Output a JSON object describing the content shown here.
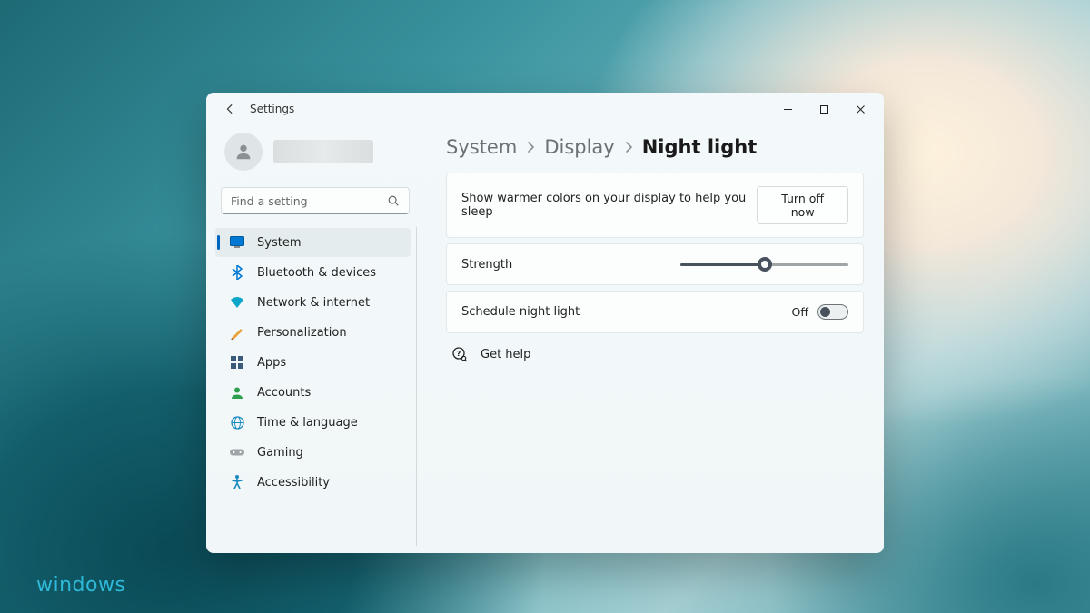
{
  "watermark": "windows",
  "window": {
    "title": "Settings"
  },
  "search": {
    "placeholder": "Find a setting"
  },
  "sidebar": {
    "items": [
      {
        "label": "System",
        "icon": "system"
      },
      {
        "label": "Bluetooth & devices",
        "icon": "bluetooth"
      },
      {
        "label": "Network & internet",
        "icon": "network"
      },
      {
        "label": "Personalization",
        "icon": "personalization"
      },
      {
        "label": "Apps",
        "icon": "apps"
      },
      {
        "label": "Accounts",
        "icon": "accounts"
      },
      {
        "label": "Time & language",
        "icon": "time-language"
      },
      {
        "label": "Gaming",
        "icon": "gaming"
      },
      {
        "label": "Accessibility",
        "icon": "accessibility"
      }
    ],
    "selected_index": 0
  },
  "breadcrumb": {
    "parts": [
      "System",
      "Display"
    ],
    "current": "Night light"
  },
  "night_light": {
    "description": "Show warmer colors on your display to help you sleep",
    "turn_off_label": "Turn off now",
    "strength_label": "Strength",
    "strength_value": 50,
    "schedule_label": "Schedule night light",
    "schedule_state_label": "Off",
    "schedule_on": false
  },
  "help": {
    "label": "Get help"
  }
}
